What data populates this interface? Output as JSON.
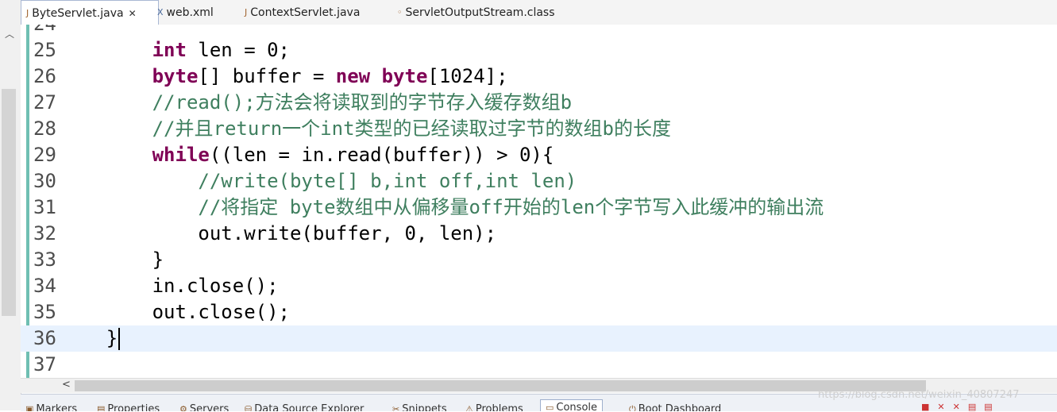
{
  "tabs": [
    {
      "label": "ByteServlet.java",
      "icon": "java-file-icon",
      "active": true,
      "closable": true
    },
    {
      "label": "web.xml",
      "icon": "xml-file-icon"
    },
    {
      "label": "ContextServlet.java",
      "icon": "java-file-icon"
    },
    {
      "label": "ServletOutputStream.class",
      "icon": "class-file-icon"
    }
  ],
  "editor": {
    "lines": [
      {
        "num": "24",
        "code": ""
      },
      {
        "num": "25",
        "code": "int len = 0;"
      },
      {
        "num": "26",
        "code": "byte[] buffer = new byte[1024];"
      },
      {
        "num": "27",
        "code": "//read();方法会将读取到的字节存入缓存数组b"
      },
      {
        "num": "28",
        "code": "//并且return一个int类型的已经读取过字节的数组b的长度"
      },
      {
        "num": "29",
        "code": "while((len = in.read(buffer)) > 0){"
      },
      {
        "num": "30",
        "code": "//write(byte[] b,int off,int len)"
      },
      {
        "num": "31",
        "code": "//将指定 byte数组中从偏移量off开始的len个字节写入此缓冲的输出流"
      },
      {
        "num": "32",
        "code": "out.write(buffer, 0, len);"
      },
      {
        "num": "33",
        "code": "}"
      },
      {
        "num": "34",
        "code": "in.close();"
      },
      {
        "num": "35",
        "code": "out.close();"
      },
      {
        "num": "36",
        "code": "}"
      },
      {
        "num": "37",
        "code": ""
      }
    ]
  },
  "bottom_tabs": [
    {
      "label": "Markers"
    },
    {
      "label": "Properties"
    },
    {
      "label": "Servers"
    },
    {
      "label": "Data Source Explorer"
    },
    {
      "label": "Snippets"
    },
    {
      "label": "Problems"
    },
    {
      "label": "Console",
      "active": true
    },
    {
      "label": "Boot Dashboard"
    }
  ],
  "watermark": "https://blog.csdn.net/weixin_40807247",
  "colors": {
    "keyword": "#7f0055",
    "comment": "#3f7f5f",
    "current_line": "#e8f2fe",
    "change_bar": "#6fbfb2"
  }
}
